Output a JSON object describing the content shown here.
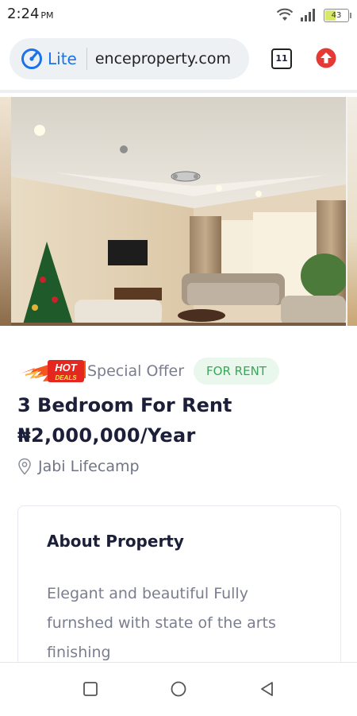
{
  "status_bar": {
    "time": "2:24",
    "ampm": "PM",
    "battery": "43",
    "battery_level": 0.43,
    "icons": [
      "wifi-icon",
      "signal-icon",
      "battery-icon"
    ]
  },
  "browser": {
    "mode_label": "Lite",
    "url": "enceproperty.com",
    "tab_count": "11",
    "icons": [
      "lite-speed-icon",
      "tabs-icon",
      "upgrade-arrow-icon"
    ],
    "accent": "#1a73e8",
    "upgrade_color": "#e53935"
  },
  "listing": {
    "badge_text_top": "HOT",
    "badge_text_bottom": "DEALS",
    "special_offer": "Special Offer",
    "status_tag": "FOR RENT",
    "title": "3 Bedroom For Rent",
    "price": "₦2,000,000/Year",
    "location": "Jabi Lifecamp"
  },
  "about": {
    "heading": "About Property",
    "description": "Elegant and beautiful Fully furnshed with state of the arts finishing"
  },
  "nav": {
    "icons": [
      "recent-apps-icon",
      "home-icon",
      "back-icon"
    ]
  }
}
